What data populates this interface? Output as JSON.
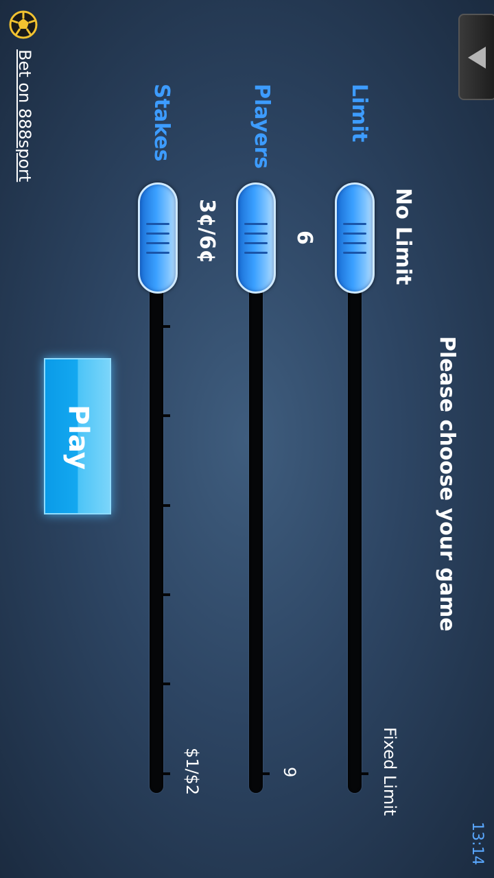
{
  "header": {
    "title": "Please choose your game",
    "time": "13:14"
  },
  "promo": {
    "link_text": "Bet on 888sport",
    "icon": "soccer-ball-icon"
  },
  "menu_button": {
    "icon": "triangle-up-icon"
  },
  "sliders": {
    "limit": {
      "label": "Limit",
      "value": "No Limit",
      "max_label": "Fixed Limit",
      "position": 0.0
    },
    "players": {
      "label": "Players",
      "value": "6",
      "max_label": "9",
      "position": 0.0
    },
    "stakes": {
      "label": "Stakes",
      "value": "3¢/6¢",
      "max_label": "$1/$2",
      "position": 0.0
    }
  },
  "play_button": {
    "label": "Play"
  },
  "colors": {
    "accent_blue": "#3d9cff",
    "play_blue": "#14a8f0",
    "time": "#5aa8ff"
  }
}
